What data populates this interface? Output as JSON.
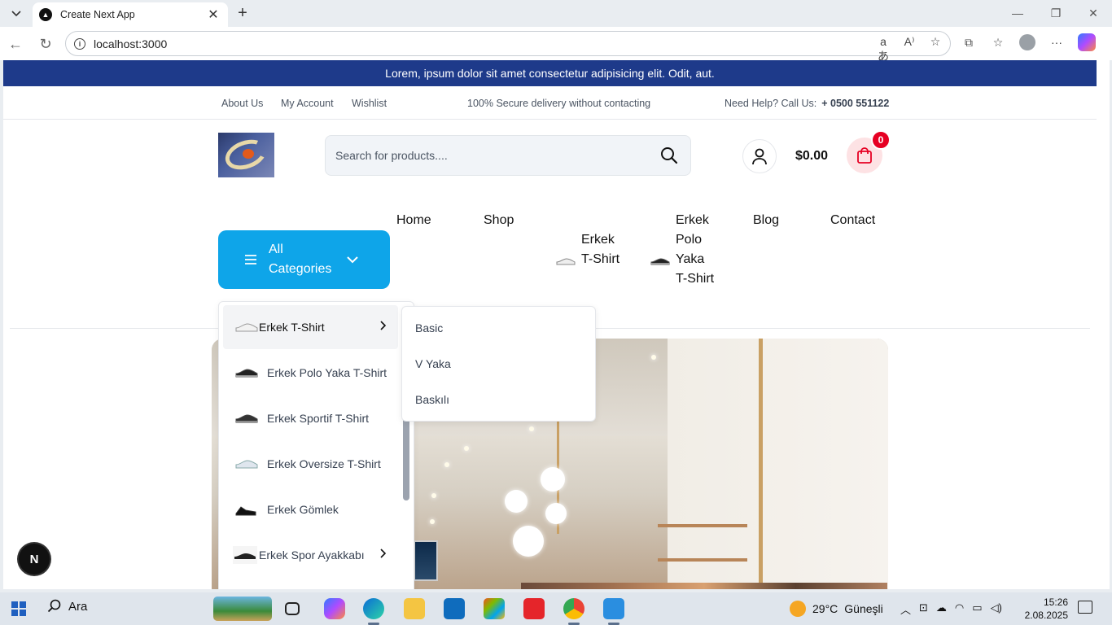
{
  "browser": {
    "tab_title": "Create Next App",
    "url": "localhost:3000"
  },
  "page": {
    "announcement": "Lorem, ipsum dolor sit amet consectetur adipisicing elit. Odit, aut.",
    "top_links": [
      "About Us",
      "My Account",
      "Wishlist"
    ],
    "secure_text": "100% Secure delivery without contacting",
    "help_text": "Need Help? Call Us:",
    "help_phone": "+ 0500 551122",
    "search_placeholder": "Search for products....",
    "cart_total": "$0.00",
    "cart_count": "0",
    "all_categories": "All Categories",
    "nav": {
      "home": "Home",
      "shop": "Shop",
      "erkek_tshirt": "Erkek T-Shirt",
      "erkek_polo": "Erkek Polo Yaka T-Shirt",
      "blog": "Blog",
      "contact": "Contact"
    },
    "categories": [
      {
        "label": "Erkek T-Shirt",
        "has_sub": true,
        "active": true
      },
      {
        "label": "Erkek Polo Yaka T-Shirt",
        "has_sub": false
      },
      {
        "label": "Erkek Sportif T-Shirt",
        "has_sub": false
      },
      {
        "label": "Erkek Oversize T-Shirt",
        "has_sub": false
      },
      {
        "label": "Erkek Gömlek",
        "has_sub": false
      },
      {
        "label": "Erkek Spor Ayakkabı",
        "has_sub": true
      }
    ],
    "subcategories": [
      "Basic",
      "V Yaka",
      "Baskılı"
    ],
    "next_badge": "N"
  },
  "taskbar": {
    "search_label": "Ara",
    "weather_temp": "29°C",
    "weather_desc": "Güneşli",
    "time": "15:26",
    "date": "2.08.2025"
  },
  "colors": {
    "announcement_bg": "#1e3a8a",
    "accent": "#0ea5e9",
    "cart_badge": "#e60023"
  }
}
